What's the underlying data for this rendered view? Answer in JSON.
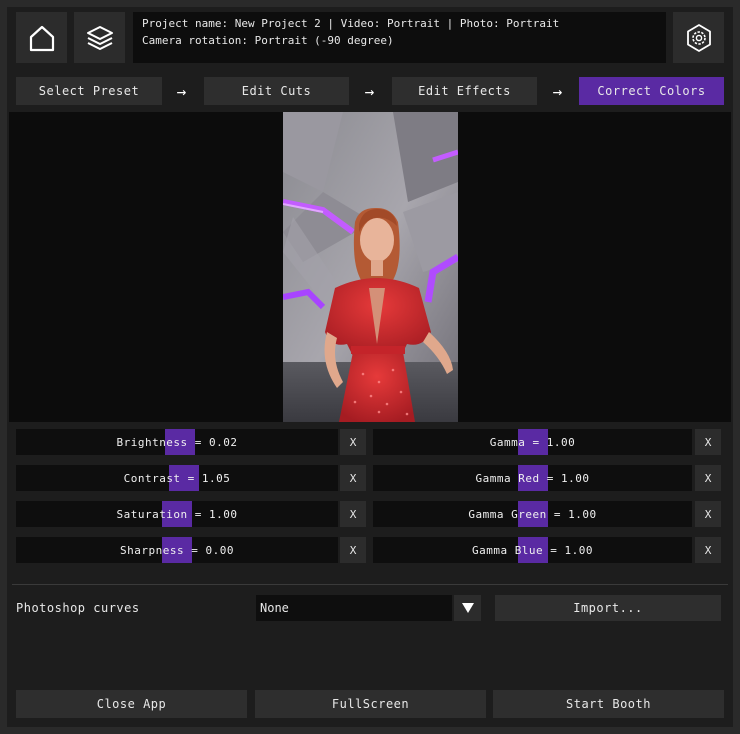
{
  "header": {
    "info_line1": "Project name: New Project 2 | Video: Portrait | Photo: Portrait",
    "info_line2": "Camera rotation: Portrait (-90 degree)"
  },
  "steps": [
    {
      "label": "Select Preset",
      "active": false
    },
    {
      "label": "Edit Cuts",
      "active": false
    },
    {
      "label": "Edit Effects",
      "active": false
    },
    {
      "label": "Correct Colors",
      "active": true
    }
  ],
  "arrow_glyph": "→",
  "sliders_left": [
    {
      "label": "Brightness = 0.02",
      "value": 0.02,
      "min": -1,
      "max": 1
    },
    {
      "label": "Contrast = 1.05",
      "value": 1.05,
      "min": 0,
      "max": 2
    },
    {
      "label": "Saturation = 1.00",
      "value": 1.0,
      "min": 0,
      "max": 2
    },
    {
      "label": "Sharpness = 0.00",
      "value": 0.0,
      "min": -1,
      "max": 1
    }
  ],
  "sliders_right": [
    {
      "label": "Gamma = 1.00",
      "value": 1.0,
      "min": 0,
      "max": 2
    },
    {
      "label": "Gamma Red = 1.00",
      "value": 1.0,
      "min": 0,
      "max": 2
    },
    {
      "label": "Gamma Green = 1.00",
      "value": 1.0,
      "min": 0,
      "max": 2
    },
    {
      "label": "Gamma Blue = 1.00",
      "value": 1.0,
      "min": 0,
      "max": 2
    }
  ],
  "reset_label": "X",
  "curves": {
    "label": "Photoshop curves",
    "selected": "None",
    "import_label": "Import..."
  },
  "footer": {
    "close_label": "Close App",
    "fullscreen_label": "FullScreen",
    "start_label": "Start Booth"
  },
  "colors": {
    "accent": "#5a2aa3",
    "dress": "#d42a2a",
    "neon": "#b04cff"
  }
}
